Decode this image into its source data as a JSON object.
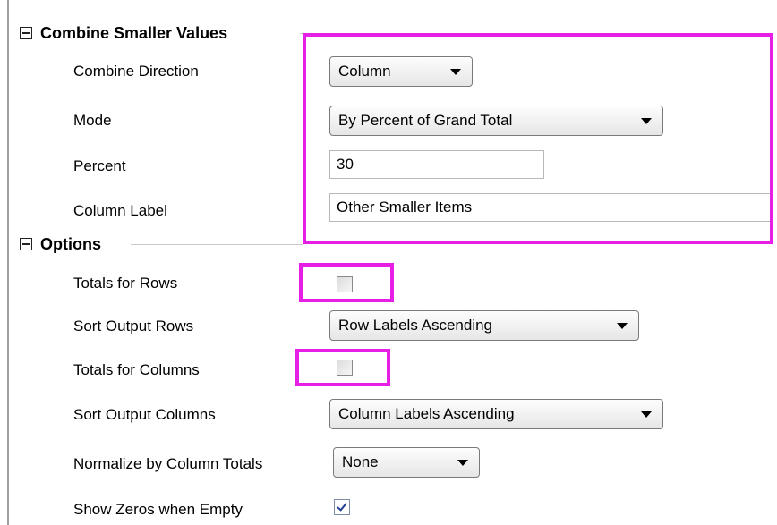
{
  "sections": {
    "combine": {
      "title": "Combine Smaller Values",
      "combine_direction": {
        "label": "Combine Direction",
        "value": "Column"
      },
      "mode": {
        "label": "Mode",
        "value": "By Percent of Grand Total"
      },
      "percent": {
        "label": "Percent",
        "value": "30"
      },
      "column_label": {
        "label": "Column Label",
        "value": "Other Smaller Items"
      }
    },
    "options": {
      "title": "Options",
      "totals_rows": {
        "label": "Totals for Rows",
        "checked": false
      },
      "sort_rows": {
        "label": "Sort Output Rows",
        "value": "Row Labels Ascending"
      },
      "totals_columns": {
        "label": "Totals for Columns",
        "checked": false
      },
      "sort_columns": {
        "label": "Sort Output Columns",
        "value": "Column Labels Ascending"
      },
      "normalize": {
        "label": "Normalize by Column Totals",
        "value": "None"
      },
      "show_zeros": {
        "label": "Show Zeros when Empty",
        "checked": true
      }
    }
  },
  "colors": {
    "highlight": "#e61ee6",
    "checkmark": "#1f3f8f"
  },
  "icons": {
    "collapse": "collapse-minus-box-icon",
    "dropdown": "dropdown-arrow-icon",
    "check": "checkmark-icon"
  }
}
